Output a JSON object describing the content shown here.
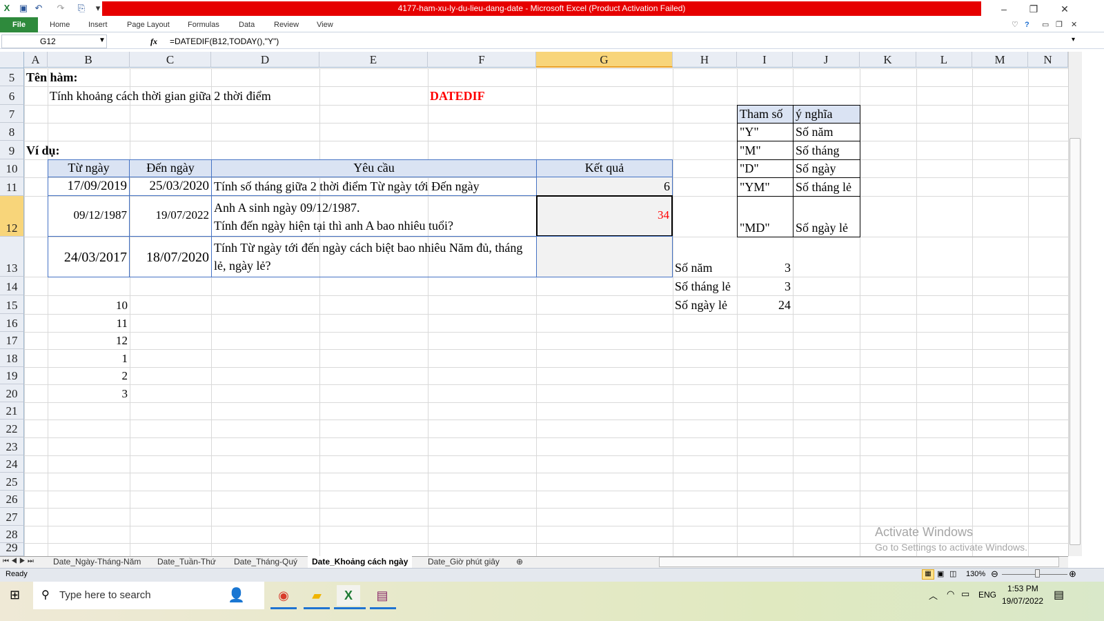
{
  "window": {
    "title": "4177-ham-xu-ly-du-lieu-dang-date  -  Microsoft Excel (Product Activation Failed)"
  },
  "ribbon": {
    "file": "File",
    "tabs": [
      "Home",
      "Insert",
      "Page Layout",
      "Formulas",
      "Data",
      "Review",
      "View"
    ]
  },
  "formula_bar": {
    "name_box": "G12",
    "fx": "fx",
    "formula": "=DATEDIF(B12,TODAY(),\"Y\")"
  },
  "columns": [
    "A",
    "B",
    "C",
    "D",
    "E",
    "F",
    "G",
    "H",
    "I",
    "J",
    "K",
    "L",
    "M",
    "N"
  ],
  "selected_column": "G",
  "selected_row": "12",
  "rows": [
    "5",
    "6",
    "7",
    "8",
    "9",
    "10",
    "11",
    "12",
    "13",
    "14",
    "15",
    "16",
    "17",
    "18",
    "19",
    "20",
    "21",
    "22",
    "23",
    "24",
    "25",
    "26",
    "27",
    "28",
    "29"
  ],
  "sheet": {
    "ten_ham_label": "Tên hàm:",
    "description": "Tính khoảng cách thời gian giữa 2 thời điểm",
    "function_name": "DATEDIF",
    "vi_du_label": "Ví dụ:",
    "table": {
      "headers": [
        "Từ ngày",
        "Đến ngày",
        "Yêu cầu",
        "Kết quả"
      ],
      "rows": [
        {
          "from": "17/09/2019",
          "to": "25/03/2020",
          "request": "Tính số tháng giữa 2 thời điểm Từ ngày tới Đến ngày",
          "result": "6"
        },
        {
          "from": "09/12/1987",
          "to": "19/07/2022",
          "request_line1": "Anh A sinh ngày 09/12/1987.",
          "request_line2": "Tính đến ngày hiện tại thì anh A bao nhiêu tuổi?",
          "result": "34"
        },
        {
          "from": "24/03/2017",
          "to": "18/07/2020",
          "request_line1": "Tính Từ ngày tới đến ngày cách biệt bao nhiêu Năm đủ, tháng",
          "request_line2": "lẻ, ngày lẻ?",
          "result": ""
        }
      ]
    },
    "param_table": {
      "headers": [
        "Tham số",
        "ý nghĩa"
      ],
      "rows": [
        [
          "\"Y\"",
          "Số năm"
        ],
        [
          "\"M\"",
          "Số tháng"
        ],
        [
          "\"D\"",
          "Số ngày"
        ],
        [
          "\"YM\"",
          "Số tháng lẻ"
        ],
        [
          "\"MD\"",
          "Số ngày lẻ"
        ]
      ]
    },
    "summary": [
      [
        "Số năm",
        "3"
      ],
      [
        "Số tháng lẻ",
        "3"
      ],
      [
        "Số ngày lẻ",
        "24"
      ]
    ],
    "col_b_values": [
      "10",
      "11",
      "12",
      "1",
      "2",
      "3"
    ]
  },
  "sheet_tabs": [
    "Date_Ngày-Tháng-Năm",
    "Date_Tuần-Thứ",
    "Date_Tháng-Quý",
    "Date_Khoảng cách ngày",
    "Date_Giờ phút giây"
  ],
  "active_sheet": "Date_Khoảng cách ngày",
  "status": {
    "ready": "Ready",
    "zoom": "130%"
  },
  "watermark": {
    "line1": "Activate Windows",
    "line2": "Go to Settings to activate Windows."
  },
  "taskbar": {
    "search_placeholder": "Type here to search",
    "time": "1:53 PM",
    "date": "19/07/2022",
    "lang": "ENG"
  },
  "colors": {
    "title_red": "#e60000",
    "accent_red": "#ff0000",
    "table_border": "#4472c4",
    "header_fill": "#dae3f3",
    "file_green": "#2e8a3c"
  }
}
